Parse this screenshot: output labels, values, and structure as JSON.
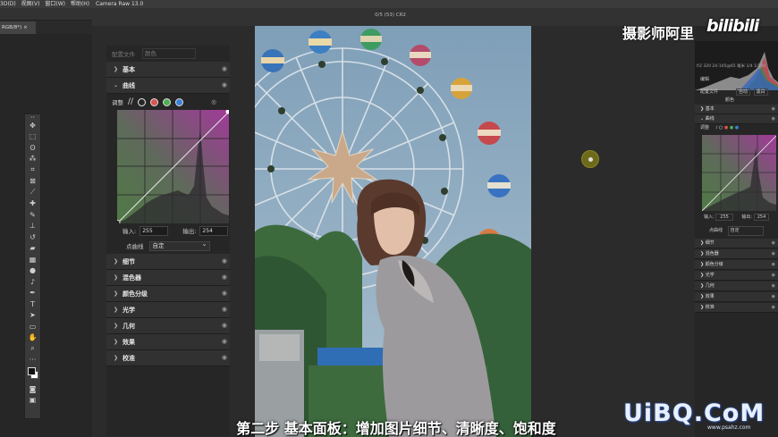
{
  "photoshop": {
    "menu": [
      "3D(D)",
      "视图(V)",
      "窗口(W)",
      "帮助(H)"
    ],
    "doc_tab": "RGB/8*)",
    "tools": [
      "move-icon",
      "marquee-icon",
      "lasso-icon",
      "magic-wand-icon",
      "crop-icon",
      "frame-icon",
      "eyedropper-icon",
      "healing-icon",
      "brush-icon",
      "stamp-icon",
      "history-brush-icon",
      "eraser-icon",
      "gradient-icon",
      "blur-icon",
      "dodge-icon",
      "pen-icon",
      "type-icon",
      "path-select-icon",
      "shape-icon",
      "hand-icon",
      "zoom-icon",
      "more-icon"
    ]
  },
  "camera_raw": {
    "title": "Camera Raw 13.0",
    "filename": "0/5 (53) CR2",
    "edit_panel": {
      "profile_label": "配置文件",
      "profile_value": "颜色",
      "sections_top": [
        {
          "label": "基本",
          "expanded": false
        },
        {
          "label": "曲线",
          "expanded": true
        }
      ],
      "curve_adjust_label": "调整",
      "input_label": "输入:",
      "input_value": "255",
      "output_label": "输出:",
      "output_value": "254",
      "point_curve_label": "点曲线",
      "point_curve_value": "自定",
      "sections_bottom": [
        "细节",
        "混色器",
        "颜色分级",
        "光学",
        "几何",
        "效果",
        "校准"
      ]
    },
    "right_panel": {
      "info": "f/2 320   24-105@65 毫米   1/4   1/200",
      "edit_label": "编辑",
      "auto_label": "自动",
      "bw_label": "黑白",
      "profile_label": "配置文件",
      "profile_value": "颜色",
      "sections_top": [
        "基本",
        "曲线"
      ],
      "adjust_label": "调整",
      "input_label": "输入:",
      "input_value": "255",
      "output_label": "输出:",
      "output_value": "254",
      "point_curve_label": "点曲线",
      "point_curve_value": "自定",
      "sections_bottom": [
        "细节",
        "混色器",
        "颜色分级",
        "光学",
        "几何",
        "效果",
        "校准"
      ]
    }
  },
  "overlay": {
    "author": "摄影师阿里",
    "bili_logo": "bilibili",
    "subtitle": "第二步  基本面板：增加图片细节、清晰度、饱和度",
    "watermark": "UiBQ.CoM",
    "watermark_url": "www.psahz.com"
  },
  "colors": {
    "accent_red": "#d9534f",
    "accent_green": "#4caf50",
    "accent_blue": "#3c7fd6",
    "curve_green": "#4f7a45",
    "curve_magenta": "#a23a9a"
  }
}
